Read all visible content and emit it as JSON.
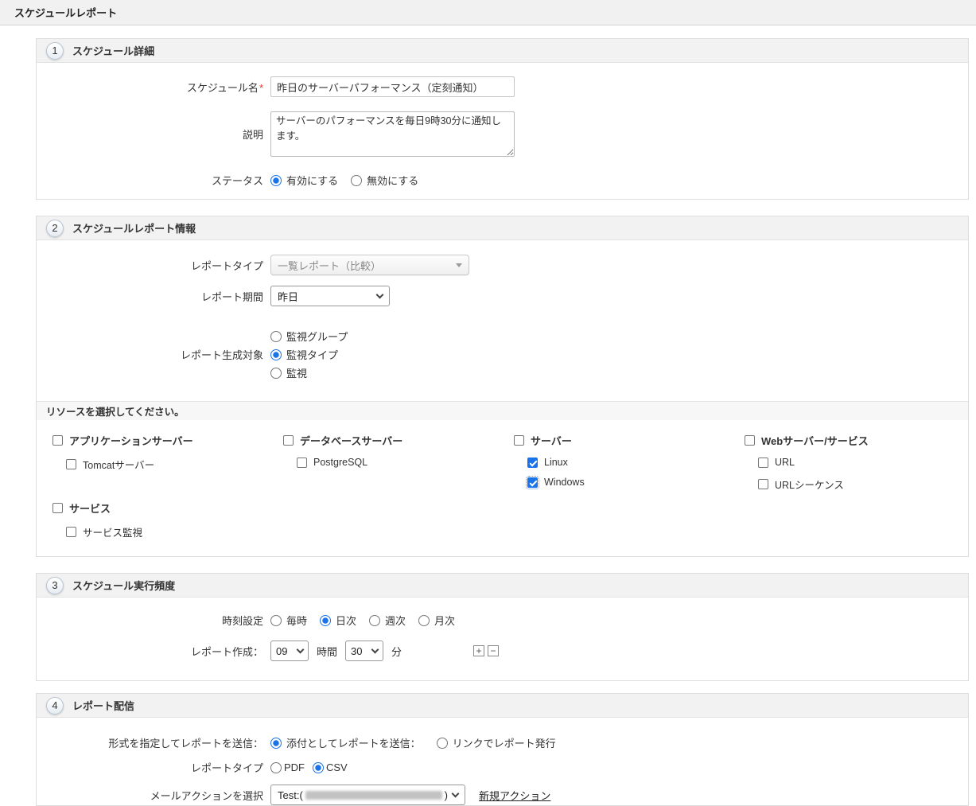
{
  "page": {
    "title": "スケジュールレポート"
  },
  "section1": {
    "number": "1",
    "title": "スケジュール詳細",
    "name_label": "スケジュール名",
    "required_mark": "*",
    "name_value": "昨日のサーバーパフォーマンス（定刻通知）",
    "desc_label": "説明",
    "desc_value": "サーバーのパフォーマンスを毎日9時30分に通知します。",
    "status_label": "ステータス",
    "status_options": [
      {
        "label": "有効にする",
        "selected": true
      },
      {
        "label": "無効にする",
        "selected": false
      }
    ],
    "status_selected": "有効にする"
  },
  "section2": {
    "number": "2",
    "title": "スケジュールレポート情報",
    "report_type_label": "レポートタイプ",
    "report_type_value": "一覧レポート（比較）",
    "period_label": "レポート期間",
    "period_value": "昨日",
    "target_label": "レポート生成対象",
    "target_options": [
      {
        "label": "監視グループ",
        "selected": false
      },
      {
        "label": "監視タイプ",
        "selected": true
      },
      {
        "label": "監視",
        "selected": false
      }
    ],
    "target_selected": "監視タイプ",
    "resource_prompt": "リソースを選択してください。",
    "groups": [
      {
        "label": "アプリケーションサーバー",
        "checked": false,
        "children": [
          {
            "label": "Tomcatサーバー",
            "checked": false
          }
        ]
      },
      {
        "label": "データベースサーバー",
        "checked": false,
        "children": [
          {
            "label": "PostgreSQL",
            "checked": false
          }
        ]
      },
      {
        "label": "サーバー",
        "checked": false,
        "children": [
          {
            "label": "Linux",
            "checked": true
          },
          {
            "label": "Windows",
            "checked": true
          }
        ]
      },
      {
        "label": "Webサーバー/サービス",
        "checked": false,
        "children": [
          {
            "label": "URL",
            "checked": false
          },
          {
            "label": "URLシーケンス",
            "checked": false
          }
        ]
      },
      {
        "label": "サービス",
        "checked": false,
        "children": [
          {
            "label": "サービス監視",
            "checked": false
          }
        ]
      }
    ]
  },
  "section3": {
    "number": "3",
    "title": "スケジュール実行頻度",
    "time_label": "時刻設定",
    "time_options": [
      {
        "label": "毎時",
        "selected": false
      },
      {
        "label": "日次",
        "selected": true
      },
      {
        "label": "週次",
        "selected": false
      },
      {
        "label": "月次",
        "selected": false
      }
    ],
    "time_selected": "日次",
    "create_label": "レポート作成：",
    "hour_value": "09",
    "hour_unit": "時間",
    "minute_value": "30",
    "minute_unit": "分",
    "add_label": "+",
    "remove_label": "−"
  },
  "section4": {
    "number": "4",
    "title": "レポート配信",
    "format_label": "形式を指定してレポートを送信：",
    "format_options": [
      {
        "label": "添付としてレポートを送信：",
        "selected": true
      },
      {
        "label": "リンクでレポート発行",
        "selected": false
      }
    ],
    "format_selected": "添付としてレポートを送信：",
    "type_label": "レポートタイプ",
    "type_options": [
      {
        "label": "PDF",
        "selected": false
      },
      {
        "label": "CSV",
        "selected": true
      }
    ],
    "type_selected": "CSV",
    "mail_label": "メールアクションを選択",
    "mail_value_prefix": "Test:(",
    "mail_value_suffix": ")",
    "new_action_label": "新規アクション"
  }
}
